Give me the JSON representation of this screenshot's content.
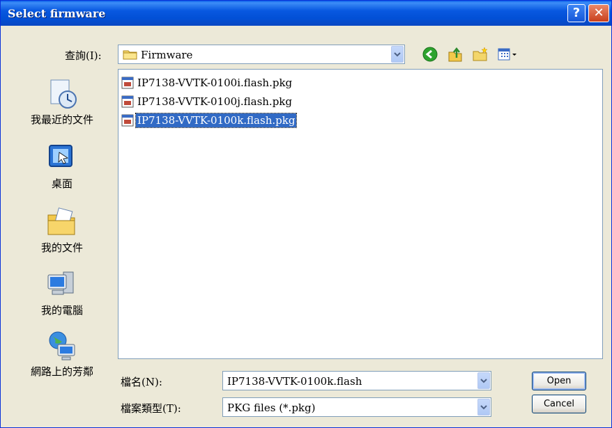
{
  "window": {
    "title": "Select firmware"
  },
  "lookin": {
    "label": "查詢(I):",
    "value": "Firmware"
  },
  "places": [
    {
      "label": "我最近的文件",
      "icon": "recent-documents-icon"
    },
    {
      "label": "桌面",
      "icon": "desktop-icon"
    },
    {
      "label": "我的文件",
      "icon": "my-documents-icon"
    },
    {
      "label": "我的電腦",
      "icon": "my-computer-icon"
    },
    {
      "label": "網路上的芳鄰",
      "icon": "network-places-icon"
    }
  ],
  "files": [
    {
      "name": "IP7138-VVTK-0100i.flash.pkg",
      "selected": false
    },
    {
      "name": "IP7138-VVTK-0100j.flash.pkg",
      "selected": false
    },
    {
      "name": "IP7138-VVTK-0100k.flash.pkg",
      "selected": true
    }
  ],
  "filename": {
    "label": "檔名(N):",
    "value": "IP7138-VVTK-0100k.flash"
  },
  "filetype": {
    "label": "檔案類型(T):",
    "value": "PKG files (*.pkg)"
  },
  "buttons": {
    "open": "Open",
    "cancel": "Cancel"
  },
  "toolbar": {
    "help_glyph": "?",
    "close_glyph": "✕",
    "icons": [
      "back-icon",
      "up-folder-icon",
      "new-folder-icon",
      "view-menu-icon"
    ]
  }
}
